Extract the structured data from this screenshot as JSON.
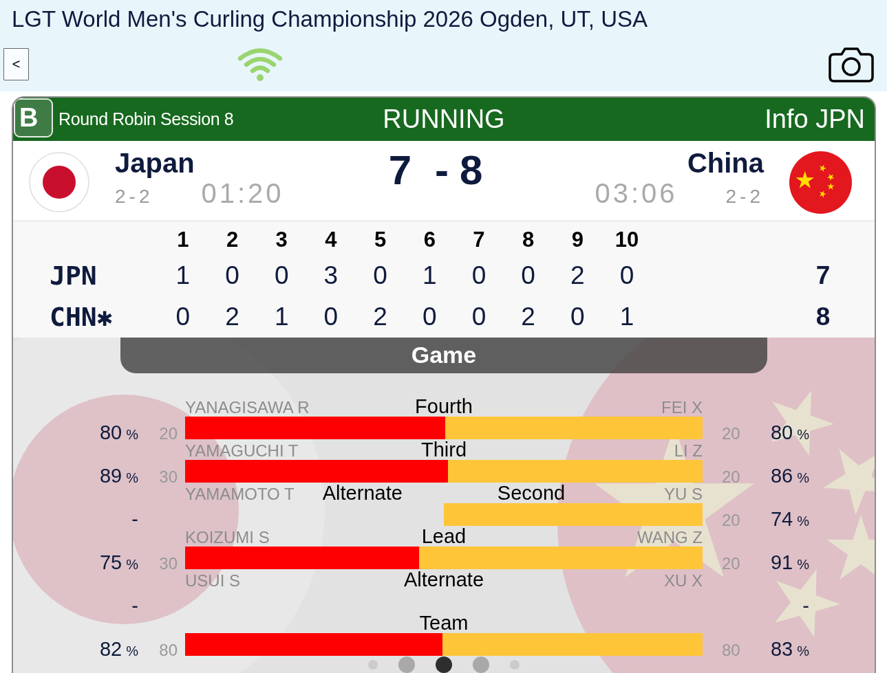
{
  "header": {
    "title": "LGT World Men's Curling Championship 2026 Ogden, UT, USA",
    "back_button": "<"
  },
  "game_bar": {
    "badge": "B",
    "session": "Round Robin Session 8",
    "status": "RUNNING",
    "info": "Info JPN"
  },
  "match": {
    "home": {
      "name": "Japan",
      "record": "2-2",
      "time": "01:20"
    },
    "score_home": "7",
    "separator": "-",
    "score_away": "8",
    "away": {
      "name": "China",
      "record": "2-2",
      "time": "03:06"
    }
  },
  "linescore": {
    "ends": [
      "1",
      "2",
      "3",
      "4",
      "5",
      "6",
      "7",
      "8",
      "9",
      "10"
    ],
    "rows": [
      {
        "team": "JPN",
        "scores": [
          "1",
          "0",
          "0",
          "3",
          "0",
          "1",
          "0",
          "0",
          "2",
          "0"
        ],
        "total": "7"
      },
      {
        "team": "CHN✱",
        "scores": [
          "0",
          "2",
          "1",
          "0",
          "2",
          "0",
          "0",
          "2",
          "0",
          "1"
        ],
        "total": "8"
      }
    ]
  },
  "stats_tab": {
    "title": "Game"
  },
  "players": [
    {
      "kind": "both",
      "positions": [
        "Fourth"
      ],
      "left": {
        "name": "YANAGISAWA R",
        "pct": "80",
        "unit": "%",
        "shots": "20"
      },
      "right": {
        "name": "FEI X",
        "pct": "80",
        "unit": "%",
        "shots": "20"
      },
      "level": 0.503
    },
    {
      "kind": "both",
      "positions": [
        "Third"
      ],
      "left": {
        "name": "YAMAGUCHI T",
        "pct": "89",
        "unit": "%",
        "shots": "30"
      },
      "right": {
        "name": "LI Z",
        "pct": "86",
        "unit": "%",
        "shots": "20"
      },
      "level": 0.508
    },
    {
      "kind": "right_only",
      "positions": [
        "Alternate",
        "Second"
      ],
      "left": {
        "name": "YAMAMOTO T",
        "pct": "-"
      },
      "right": {
        "name": "YU S",
        "pct": "74",
        "unit": "%",
        "shots": "20"
      }
    },
    {
      "kind": "both",
      "positions": [
        "Lead"
      ],
      "left": {
        "name": "KOIZUMI S",
        "pct": "75",
        "unit": "%",
        "shots": "30"
      },
      "right": {
        "name": "WANG Z",
        "pct": "91",
        "unit": "%",
        "shots": "20"
      },
      "level": 0.452
    },
    {
      "kind": "none",
      "positions": [
        "Alternate"
      ],
      "left": {
        "name": "USUI S",
        "pct": "-"
      },
      "right": {
        "name": "XU X",
        "pct": "-"
      }
    },
    {
      "kind": "both",
      "positions": [
        "Team"
      ],
      "left": {
        "pct": "82",
        "unit": "%",
        "shots": "80"
      },
      "right": {
        "pct": "83",
        "unit": "%",
        "shots": "80"
      },
      "level": 0.497
    }
  ],
  "page_dots": [
    {
      "selected": false
    },
    {
      "selected": false
    },
    {
      "selected": true
    },
    {
      "selected": false
    },
    {
      "selected": false
    }
  ]
}
